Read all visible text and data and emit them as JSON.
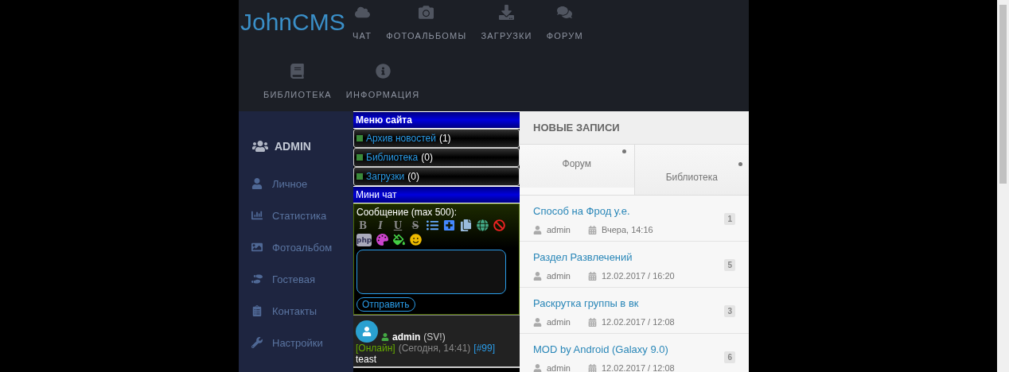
{
  "header": {
    "logo": "JohnCMS",
    "nav": [
      {
        "label": "ЧАТ"
      },
      {
        "label": "ФОТОАЛЬБОМЫ"
      },
      {
        "label": "ЗАГРУЗКИ"
      },
      {
        "label": "ФОРУМ"
      },
      {
        "label": "БИБЛИОТЕКА"
      },
      {
        "label": "ИНФОРМАЦИЯ"
      }
    ]
  },
  "sidebar": {
    "title": "ADMIN",
    "items": [
      {
        "label": "Личное"
      },
      {
        "label": "Статистика"
      },
      {
        "label": "Фотоальбом"
      },
      {
        "label": "Гостевая"
      },
      {
        "label": "Контакты"
      },
      {
        "label": "Настройки"
      }
    ]
  },
  "site_menu": {
    "title": "Меню сайта",
    "items": [
      {
        "link": "Архив новостей",
        "count": "(1)"
      },
      {
        "link": "Библиотека",
        "count": "(0)"
      },
      {
        "link": "Загрузки",
        "count": "(0)"
      }
    ]
  },
  "mini_chat": {
    "title": "Мини чат",
    "form_label": "Сообщение (max 500):",
    "toolbar": [
      {
        "kind": "bold",
        "label": "B"
      },
      {
        "kind": "italic",
        "label": "I"
      },
      {
        "kind": "underline",
        "label": "U"
      },
      {
        "kind": "strike",
        "label": "S"
      },
      {
        "kind": "list"
      },
      {
        "kind": "plus"
      },
      {
        "kind": "copy"
      },
      {
        "kind": "globe"
      },
      {
        "kind": "ban"
      },
      {
        "kind": "php",
        "label": "php"
      },
      {
        "kind": "color"
      },
      {
        "kind": "bgcolor"
      },
      {
        "kind": "smile"
      }
    ],
    "submit": "Отправить",
    "post": {
      "author": "admin",
      "note": "(SV!)",
      "status": "[Онлайн]",
      "time": "(Сегодня, 14:41)",
      "id": "[#99]",
      "text": "teast"
    }
  },
  "new_posts": {
    "title": "НОВЫЕ ЗАПИСИ",
    "tabs": [
      {
        "label": "Форум",
        "selected": true
      },
      {
        "label": "Библиотека",
        "selected": false
      }
    ],
    "items": [
      {
        "title": "Способ на Фрод у.е.",
        "author": "admin",
        "date": "Вчера, 14:16",
        "count": "1"
      },
      {
        "title": "Раздел Развлечений",
        "author": "admin",
        "date": "12.02.2017 / 16:20",
        "count": "5"
      },
      {
        "title": "Раскрутка группы в вк",
        "author": "admin",
        "date": "12.02.2017 / 12:08",
        "count": "3"
      },
      {
        "title": "MOD by Android (Galaxy 9.0)",
        "author": "admin",
        "date": "12.02.2017 / 12:08",
        "count": "6"
      }
    ]
  }
}
